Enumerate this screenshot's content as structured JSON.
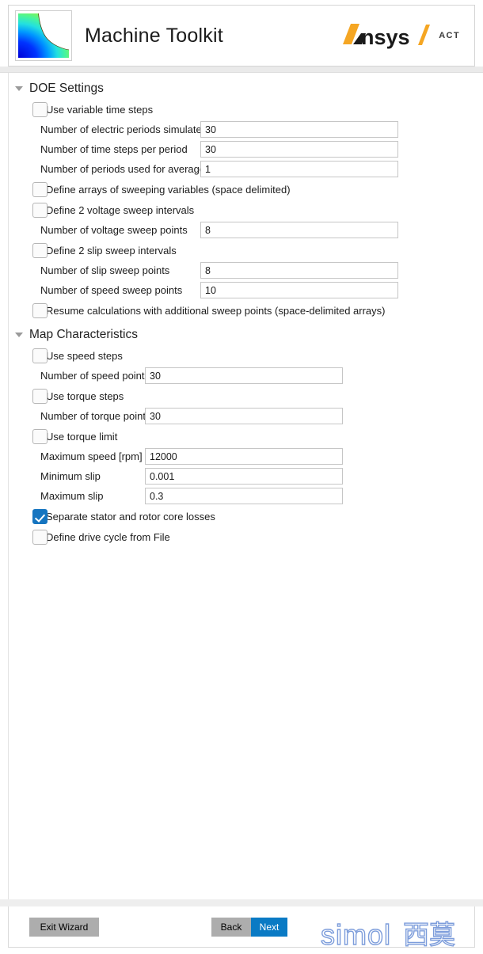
{
  "header": {
    "app_title": "Machine Toolkit",
    "brand_name": "Ansys",
    "brand_suffix": "ACT",
    "brand_separator": "/",
    "logo_icon": "contour-plot-icon",
    "brand_accent_color": "#f5a623"
  },
  "sections": [
    {
      "id": "doe",
      "title": "DOE Settings",
      "expanded": true,
      "collapse_icon": "triangle-down-icon",
      "rows": [
        {
          "type": "checkbox",
          "name": "use-variable-time-steps",
          "label": "Use variable time steps",
          "checked": false
        },
        {
          "type": "field",
          "name": "number-of-electric-periods-simulated",
          "label": "Number of electric periods simulated",
          "value": "30"
        },
        {
          "type": "field",
          "name": "number-of-time-steps-per-period",
          "label": "Number of time steps per period",
          "value": "30"
        },
        {
          "type": "field",
          "name": "number-of-periods-used-for-average",
          "label": "Number of periods used for average",
          "value": "1"
        },
        {
          "type": "checkbox",
          "name": "define-arrays-of-sweeping-variables",
          "label": "Define arrays of sweeping variables (space delimited)",
          "checked": false
        },
        {
          "type": "checkbox",
          "name": "define-2-voltage-sweep-intervals",
          "label": "Define 2 voltage sweep intervals",
          "checked": false
        },
        {
          "type": "field",
          "name": "number-of-voltage-sweep-points",
          "label": "Number of voltage sweep points",
          "value": "8"
        },
        {
          "type": "checkbox",
          "name": "define-2-slip-sweep-intervals",
          "label": "Define 2 slip sweep intervals",
          "checked": false
        },
        {
          "type": "field",
          "name": "number-of-slip-sweep-points",
          "label": "Number of slip sweep points",
          "value": "8"
        },
        {
          "type": "field",
          "name": "number-of-speed-sweep-points",
          "label": "Number of speed sweep points",
          "value": "10"
        },
        {
          "type": "checkbox",
          "name": "resume-calculations-with-additional-sweep-points",
          "label": "Resume calculations with additional sweep points (space-delimited arrays)",
          "checked": false
        }
      ]
    },
    {
      "id": "map",
      "title": "Map Characteristics",
      "expanded": true,
      "collapse_icon": "triangle-down-icon",
      "rows": [
        {
          "type": "checkbox",
          "name": "use-speed-steps",
          "label": "Use speed steps",
          "checked": false
        },
        {
          "type": "field",
          "name": "number-of-speed-points",
          "label": "Number of speed points",
          "value": "30"
        },
        {
          "type": "checkbox",
          "name": "use-torque-steps",
          "label": "Use torque steps",
          "checked": false
        },
        {
          "type": "field",
          "name": "number-of-torque-points",
          "label": "Number of torque points",
          "value": "30"
        },
        {
          "type": "checkbox",
          "name": "use-torque-limit",
          "label": "Use torque limit",
          "checked": false
        },
        {
          "type": "field",
          "name": "maximum-speed-rpm",
          "label": "Maximum speed [rpm]",
          "value": "12000"
        },
        {
          "type": "field",
          "name": "minimum-slip",
          "label": "Minimum slip",
          "value": "0.001"
        },
        {
          "type": "field",
          "name": "maximum-slip",
          "label": "Maximum slip",
          "value": "0.3"
        },
        {
          "type": "checkbox",
          "name": "separate-stator-and-rotor-core-losses",
          "label": "Separate stator and rotor core losses",
          "checked": true
        },
        {
          "type": "checkbox",
          "name": "define-drive-cycle-from-file",
          "label": "Define drive cycle from File",
          "checked": false
        }
      ]
    }
  ],
  "footer": {
    "exit_label": "Exit Wizard",
    "back_label": "Back",
    "next_label": "Next",
    "next_color": "#0a7ac4",
    "gray_color": "#adadad",
    "watermark_latin": "simol",
    "watermark_cjk": "西莫",
    "watermark_color": "#7d9ddb"
  }
}
